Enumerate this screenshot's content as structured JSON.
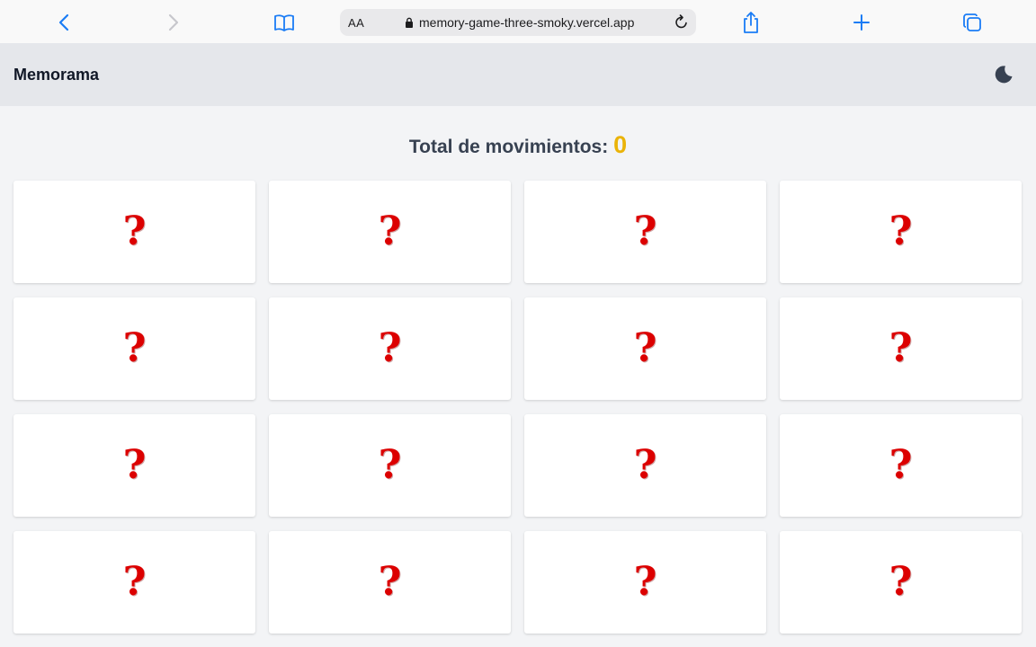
{
  "browser": {
    "text_size_label": "AA",
    "url": "memory-game-three-smoky.vercel.app",
    "accent_color": "#1a7cf5"
  },
  "app": {
    "title": "Memorama",
    "theme_icon": "moon-icon"
  },
  "game": {
    "moves_label": "Total de movimientos:",
    "moves_count": "0",
    "card_symbol": "?",
    "cards": [
      {
        "face": "?"
      },
      {
        "face": "?"
      },
      {
        "face": "?"
      },
      {
        "face": "?"
      },
      {
        "face": "?"
      },
      {
        "face": "?"
      },
      {
        "face": "?"
      },
      {
        "face": "?"
      },
      {
        "face": "?"
      },
      {
        "face": "?"
      },
      {
        "face": "?"
      },
      {
        "face": "?"
      },
      {
        "face": "?"
      },
      {
        "face": "?"
      },
      {
        "face": "?"
      },
      {
        "face": "?"
      }
    ],
    "symbol_color": "#dc0000",
    "count_color": "#eab308"
  }
}
